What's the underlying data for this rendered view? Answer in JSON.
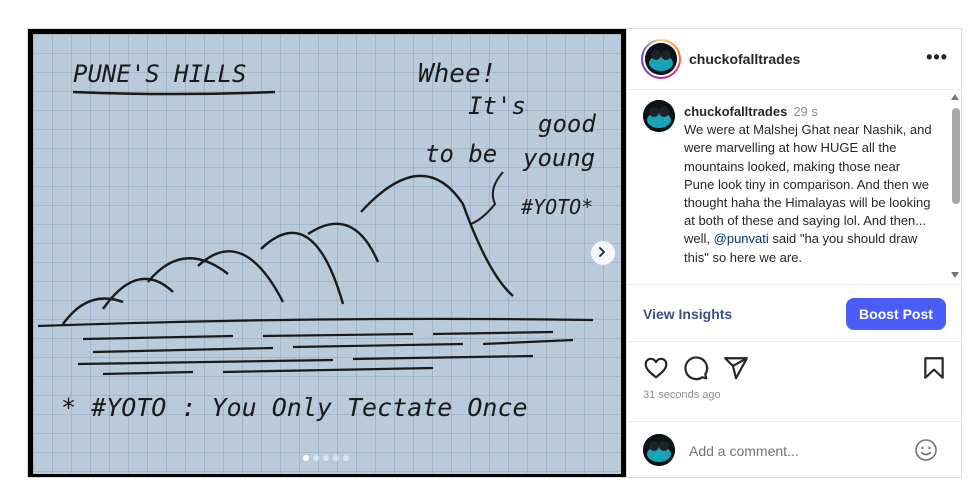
{
  "post": {
    "username": "chuckofalltrades",
    "more_label": "•••",
    "image": {
      "handwriting": {
        "title": "PUNE'S HILLS",
        "quote_line1": "Whee!",
        "quote_line2": "It's",
        "quote_line3": "good",
        "quote_line4": "to be",
        "quote_line5": "young",
        "quote_tag": "#YOTO*",
        "footnote": "* #YOTO : You Only Tectate Once"
      },
      "carousel_total": 5,
      "carousel_active": 1
    },
    "caption": {
      "username": "chuckofalltrades",
      "time": "29 s",
      "text_before": "We were at Malshej Ghat near Nashik, and were marvelling at how HUGE all the mountains looked, making those near Pune look tiny in comparison. And then we thought haha the Himalayas will be looking at both of these and saying lol. And then... well,",
      "mention": "@punvati",
      "text_after": "said \"ha you should draw this\" so here we are."
    },
    "insights_label": "View Insights",
    "boost_label": "Boost Post",
    "posted_ago": "31 seconds ago",
    "comment": {
      "placeholder": "Add a comment..."
    },
    "icons": {
      "like": "heart-icon",
      "comment": "comment-icon",
      "share": "share-icon",
      "save": "bookmark-icon",
      "emoji": "emoji-icon",
      "next": "chevron-right-icon"
    },
    "colors": {
      "boost": "#4a5df9",
      "insights": "#385185",
      "mention": "#00376b"
    }
  }
}
